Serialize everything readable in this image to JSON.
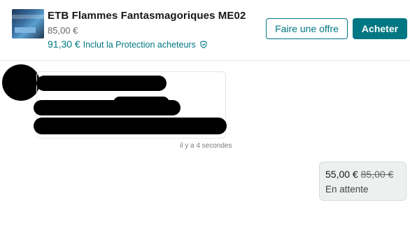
{
  "item": {
    "title": "ETB Flammes Fantasmagoriques ME02",
    "price": "85,00 €",
    "total_price": "91,30 €",
    "protection_text": "Inclut la Protection acheteurs"
  },
  "actions": {
    "offer_label": "Faire une offre",
    "buy_label": "Acheter"
  },
  "conversation": {
    "message_time": "il y a 4 secondes",
    "offer": {
      "new_price": "55,00 €",
      "old_price": "85,00 €",
      "status": "En attente"
    }
  },
  "colors": {
    "accent": "#007782",
    "redaction": "#000000"
  },
  "icons": [
    "shield-icon",
    "item-thumbnail"
  ]
}
